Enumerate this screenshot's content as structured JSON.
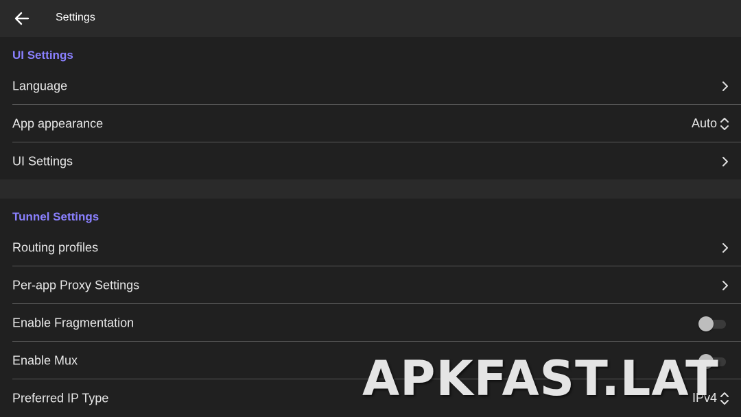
{
  "topbar": {
    "title": "Settings",
    "back_icon": "arrow-left-icon"
  },
  "ui_section": {
    "header": "UI Settings",
    "items": [
      {
        "label": "Language",
        "control": "chevron"
      },
      {
        "label": "App appearance",
        "control": "select",
        "value": "Auto"
      },
      {
        "label": "UI Settings",
        "control": "chevron"
      }
    ]
  },
  "tunnel_section": {
    "header": "Tunnel Settings",
    "items": [
      {
        "label": "Routing profiles",
        "control": "chevron"
      },
      {
        "label": "Per-app Proxy Settings",
        "control": "chevron"
      },
      {
        "label": "Enable Fragmentation",
        "control": "toggle",
        "enabled": false
      },
      {
        "label": "Enable Mux",
        "control": "toggle",
        "enabled": false
      },
      {
        "label": "Preferred IP Type",
        "control": "select",
        "value": "IPv4"
      }
    ]
  },
  "watermark": {
    "text": "APKFAST.LAT"
  },
  "colors": {
    "accent": "#8a80ff",
    "background": "#202020",
    "topbar": "#2a2a2a",
    "divider": "#5a5a5a"
  }
}
